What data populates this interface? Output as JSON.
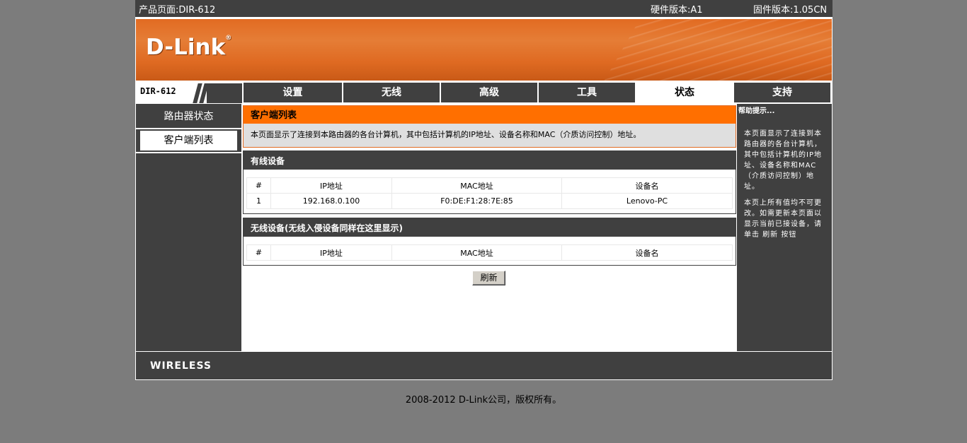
{
  "topbar": {
    "product": "产品页面:DIR-612",
    "hardware": "硬件版本:A1",
    "firmware": "固件版本:1.05CN"
  },
  "brand": {
    "logo": "D-Link",
    "model": "DIR-612",
    "accent": "#ff6f00",
    "dark": "#404040"
  },
  "nav": {
    "tabs": [
      {
        "label": "设置"
      },
      {
        "label": "无线"
      },
      {
        "label": "高级"
      },
      {
        "label": "工具"
      },
      {
        "label": "状态",
        "active": true
      },
      {
        "label": "支持"
      }
    ]
  },
  "sidebar": {
    "items": [
      {
        "label": "路由器状态"
      },
      {
        "label": "客户端列表",
        "selected": true
      }
    ]
  },
  "main": {
    "title": "客户端列表",
    "description": "本页面显示了连接到本路由器的各台计算机，其中包括计算机的IP地址、设备名称和MAC（介质访问控制）地址。",
    "wired": {
      "title": "有线设备",
      "headers": [
        "#",
        "IP地址",
        "MAC地址",
        "设备名"
      ],
      "rows": [
        [
          "1",
          "192.168.0.100",
          "F0:DE:F1:28:7E:85",
          "Lenovo-PC"
        ]
      ]
    },
    "wireless": {
      "title": "无线设备(无线入侵设备同样在这里显示)",
      "headers": [
        "#",
        "IP地址",
        "MAC地址",
        "设备名"
      ]
    },
    "refresh_label": "刷新"
  },
  "help": {
    "title": "帮助提示...",
    "p1": "本页面显示了连接到本路由器的各台计算机，其中包括计算机的IP地址、设备名称和MAC（介质访问控制）地址。",
    "p2": "本页上所有值均不可更改。如需更新本页面以显示当前已接设备，请单击 刷新 按钮"
  },
  "footer": {
    "wireless": "WIRELESS",
    "copyright": "2008-2012 D-Link公司，版权所有。"
  }
}
